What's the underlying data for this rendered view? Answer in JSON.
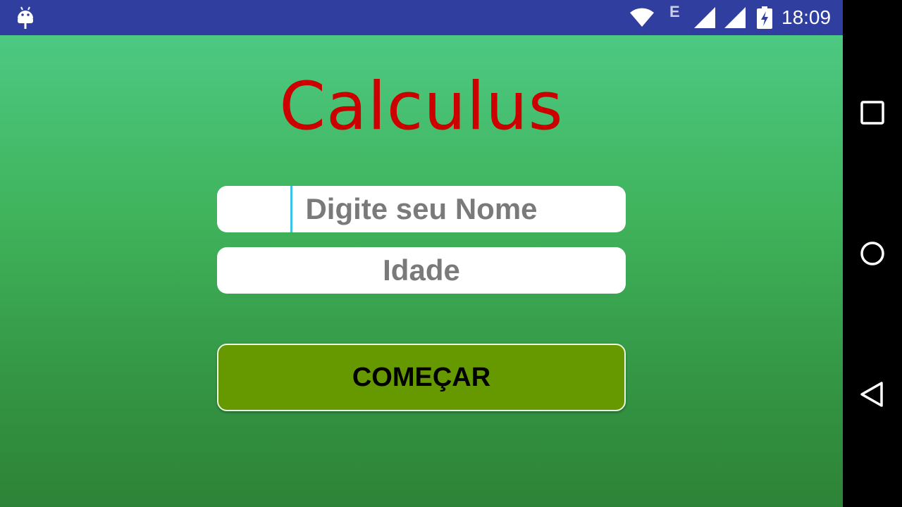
{
  "status_bar": {
    "network_type": "E",
    "time": "18:09",
    "icons": [
      "android-debug-icon",
      "wifi-icon",
      "signal-icon",
      "signal-icon",
      "battery-charging-icon"
    ]
  },
  "app": {
    "title": "Calculus",
    "name_input": {
      "placeholder": "Digite seu Nome",
      "value": ""
    },
    "age_input": {
      "placeholder": "Idade",
      "value": ""
    },
    "start_button_label": "COMEÇAR",
    "colors": {
      "title": "#cc0000",
      "button": "#669900",
      "background_top": "#4dc982",
      "background_bottom": "#2e8337",
      "status_bar": "#303f9f"
    }
  },
  "nav_bar": {
    "icons": [
      "recents-icon",
      "home-icon",
      "back-icon"
    ]
  }
}
